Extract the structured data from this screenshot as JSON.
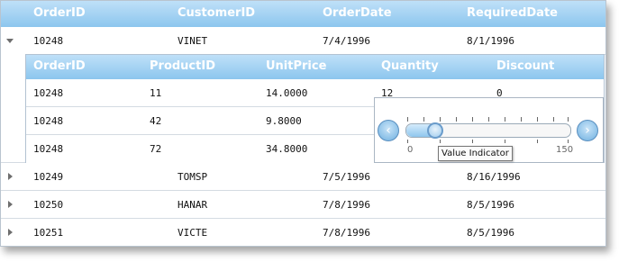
{
  "columns": [
    "OrderID",
    "CustomerID",
    "OrderDate",
    "RequiredDate"
  ],
  "orders": [
    {
      "id": "10248",
      "customer": "VINET",
      "order_date": "7/4/1996",
      "required_date": "8/1/1996",
      "expanded": true
    },
    {
      "id": "10249",
      "customer": "TOMSP",
      "order_date": "7/5/1996",
      "required_date": "8/16/1996",
      "expanded": false
    },
    {
      "id": "10250",
      "customer": "HANAR",
      "order_date": "7/8/1996",
      "required_date": "8/5/1996",
      "expanded": false
    },
    {
      "id": "10251",
      "customer": "VICTE",
      "order_date": "7/8/1996",
      "required_date": "8/5/1996",
      "expanded": false
    }
  ],
  "detail_columns": [
    "OrderID",
    "ProductID",
    "UnitPrice",
    "Quantity",
    "Discount"
  ],
  "details": [
    {
      "order_id": "10248",
      "product_id": "11",
      "unit_price": "14.0000",
      "quantity": "12",
      "discount": "0"
    },
    {
      "order_id": "10248",
      "product_id": "42",
      "unit_price": "9.8000",
      "quantity": "",
      "discount": ""
    },
    {
      "order_id": "10248",
      "product_id": "72",
      "unit_price": "34.8000",
      "quantity": "",
      "discount": ""
    }
  ],
  "slider": {
    "min_label": "0",
    "max_label": "150",
    "value": 22,
    "min": 0,
    "max": 150,
    "tooltip": "Value Indicator",
    "left_icon": "chevron-left-icon",
    "right_icon": "chevron-right-icon"
  },
  "colors": {
    "header_top": "#bfe0f8",
    "header_bottom": "#8cc6ee",
    "border": "#b9c4cf"
  }
}
